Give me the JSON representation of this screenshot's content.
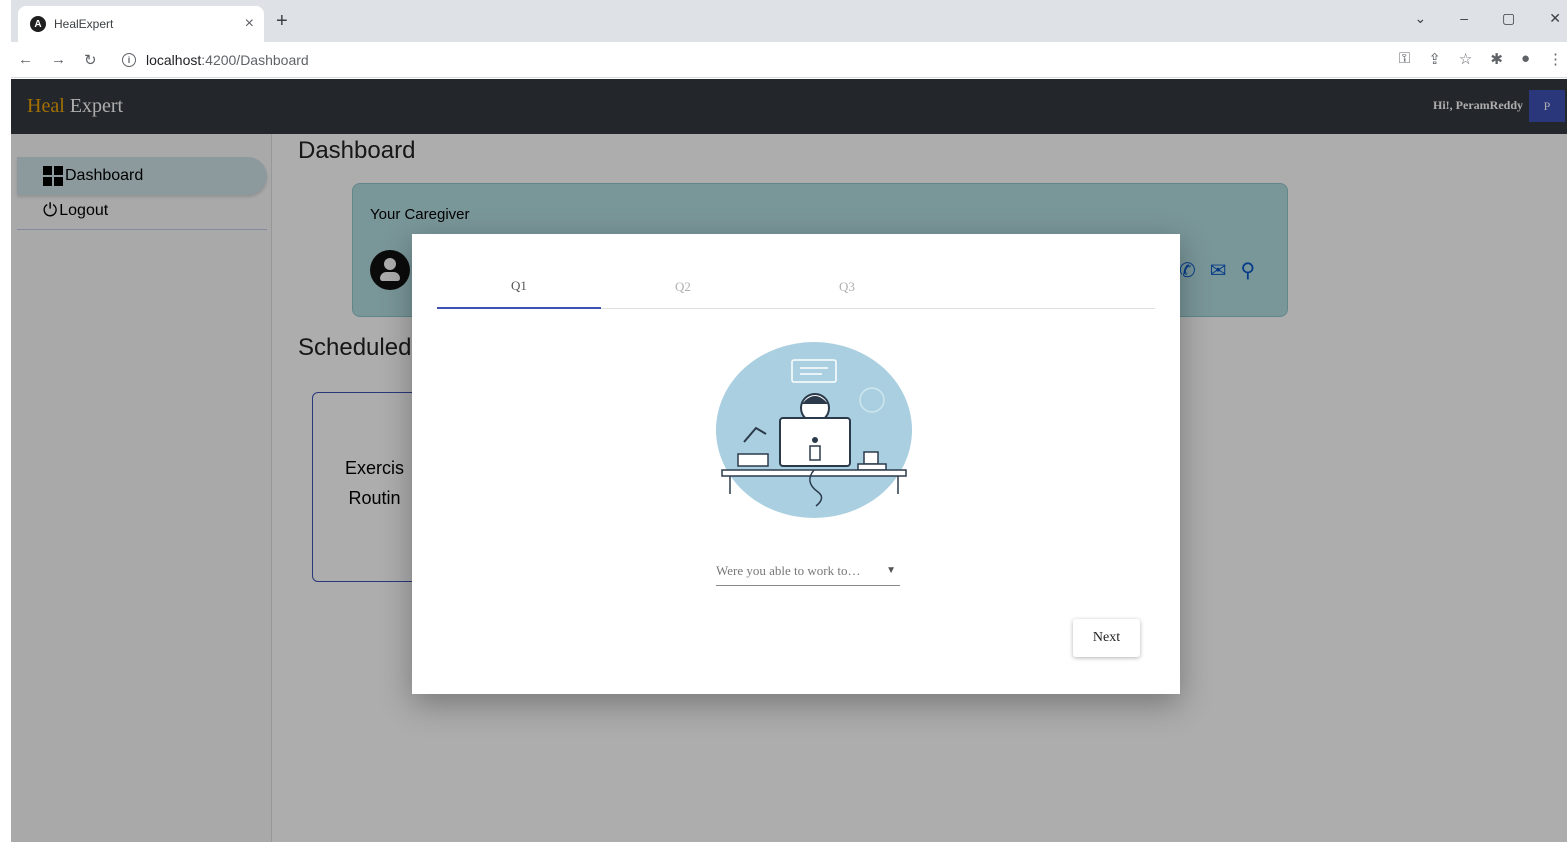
{
  "browser": {
    "tab_title": "HealExpert",
    "tab_favicon": "A",
    "tab_close": "×",
    "new_tab": "+",
    "url_host": "localhost",
    "url_path": ":4200/Dashboard",
    "window_controls": [
      "⌄",
      "–",
      "▢",
      "✕"
    ],
    "toolbar_icons": [
      "key-icon",
      "share-icon",
      "star-icon",
      "extensions-icon",
      "profile-icon",
      "menu-icon"
    ]
  },
  "header": {
    "brand_part1": "Heal",
    "brand_part2": " Expert",
    "greeting": "Hi!, PeramReddy",
    "avatar_letter": "P"
  },
  "sidebar": {
    "items": [
      {
        "label": "Dashboard",
        "icon": "dashboard-icon",
        "active": true
      },
      {
        "label": "Logout",
        "icon": "power-icon",
        "active": false
      }
    ]
  },
  "main": {
    "title": "Dashboard",
    "caregiver_label": "Your Caregiver",
    "scheduled_title": "Scheduled",
    "exercise_line1": "Exercis",
    "exercise_line2": "Routin"
  },
  "modal": {
    "tabs": [
      {
        "label": "Q1",
        "active": true
      },
      {
        "label": "Q2",
        "active": false
      },
      {
        "label": "Q3",
        "active": false
      }
    ],
    "select_value": "Were you able to work to…",
    "next_label": "Next"
  },
  "colors": {
    "header_bg": "#343a40",
    "brand_accent": "#f0a500",
    "caregiver_card": "#b3dde2",
    "primary": "#3f51b5",
    "contact_icons": "#0a58ca"
  }
}
